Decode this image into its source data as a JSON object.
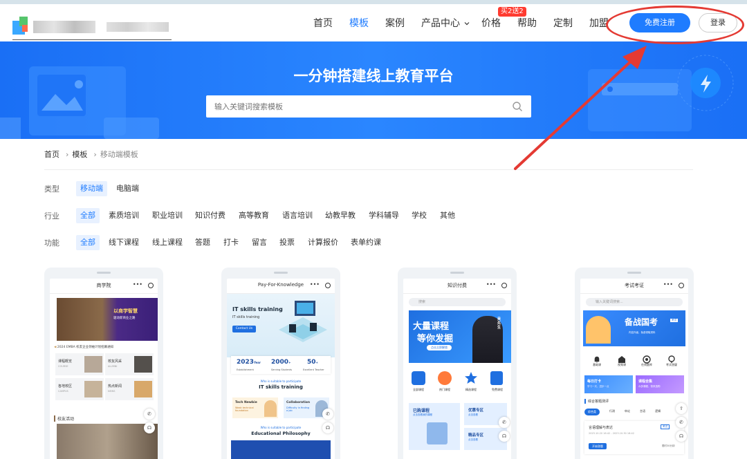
{
  "nav": {
    "items": [
      {
        "label": "首页"
      },
      {
        "label": "模板"
      },
      {
        "label": "案例"
      },
      {
        "label": "产品中心"
      },
      {
        "label": "价格"
      },
      {
        "label": "帮助"
      },
      {
        "label": "定制"
      },
      {
        "label": "加盟"
      }
    ],
    "promo_badge": "买2送2",
    "signup_label": "免费注册",
    "login_label": "登录"
  },
  "banner": {
    "title": "一分钟搭建线上教育平台",
    "search_placeholder": "输入关键词搜索模板"
  },
  "breadcrumb": {
    "home": "首页",
    "templates": "模板",
    "current": "移动端模板"
  },
  "filters": {
    "type": {
      "label": "类型",
      "options": [
        "移动端",
        "电脑端"
      ]
    },
    "industry": {
      "label": "行业",
      "options": [
        "全部",
        "素质培训",
        "职业培训",
        "知识付费",
        "高等教育",
        "语言培训",
        "幼教早教",
        "学科辅导",
        "学校",
        "其他"
      ]
    },
    "function": {
      "label": "功能",
      "options": [
        "全部",
        "线下课程",
        "线上课程",
        "答题",
        "打卡",
        "留言",
        "投票",
        "计算报价",
        "表单约课"
      ]
    }
  },
  "cards": [
    {
      "title": "商学院",
      "banner_text": "以商学智慧",
      "banner_sub": "驱动新商业之路",
      "notice": "2024 EMBA 校友企业领袖计划招募通知",
      "tiles": [
        {
          "title": "课程概览",
          "sub": "COURSE"
        },
        {
          "title": "校友风采",
          "sub": "ALUMNI"
        },
        {
          "title": "各地校区",
          "sub": "CAMPUS"
        },
        {
          "title": "热点新闻",
          "sub": "NEWS"
        }
      ],
      "section": "校友活动"
    },
    {
      "title": "Pay-For-Knowledge",
      "hero_title": "IT skills training",
      "hero_sub": "IT skills training",
      "hero_btn": "Contact Us",
      "stats": [
        {
          "value": "2023",
          "unit": "Year",
          "label": "Establishment"
        },
        {
          "value": "2000",
          "unit": "+",
          "label": "Serving Students"
        },
        {
          "value": "50",
          "unit": "+",
          "label": "Excellent Teacher"
        }
      ],
      "who_small": "Who is suitable to participate",
      "who_title": "IT skills training",
      "tech_title": "Tech Newbie",
      "tech_sub": "Weak technical foundation",
      "collab_title": "Collaboration",
      "collab_sub": "Difficulty in finding a job",
      "who2_small": "Who is suitable to participate",
      "who2_title": "Educational Philosophy"
    },
    {
      "title": "知识付费",
      "search": "搜索",
      "banner_big1": "大量课程",
      "banner_big2": "等你发掘",
      "banner_pill": "点击立即解锁",
      "banner_name": "吴先生",
      "icons": [
        "全部课程",
        "热门课程",
        "精选课程",
        "免费课程"
      ],
      "promo1_title": "已购课程",
      "promo1_sub": "点击查看我的课程",
      "promo2_title": "优惠专区",
      "promo2_sub": "点击查看",
      "promo3_title": "精品专区",
      "promo3_sub": "点击查看"
    },
    {
      "title": "考试考证",
      "search": "输入关键词搜索...",
      "banner_big": "备战国考",
      "banner_tag": "考试",
      "banner_sub": "内容升级，免费领取资料",
      "icons": [
        "基础课",
        "视频课",
        "在线题库",
        "考试答疑"
      ],
      "tile1_title": "每日打卡",
      "tile1_sub": "学习一天，进步一点",
      "tile2_title": "课程合集",
      "tile2_sub": "众多课程，快来选购",
      "section": "综合答题测评",
      "tabs": [
        "综合类",
        "行测",
        "申论",
        "言语",
        "逻辑"
      ],
      "item_title": "言语理解与表达",
      "item_badge": "考试",
      "item_date": "2023.10.20 16:42 - 2023.10.30 16:42",
      "item_btn": "开始答题",
      "item_meta": "限时30分钟"
    }
  ],
  "colors": {
    "accent": "#1f7cff",
    "banner": "#2a86ff",
    "annotation": "#e43a33",
    "badge": "#ff3b30"
  }
}
